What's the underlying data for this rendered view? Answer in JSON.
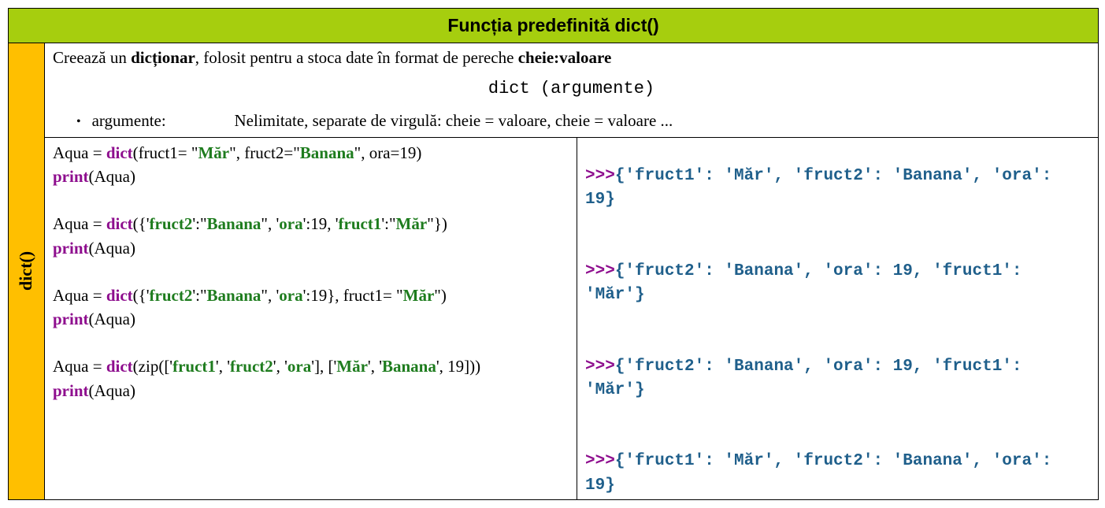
{
  "header": "Funcția predefinită dict()",
  "sidebar": "dict()",
  "desc": {
    "p1a": "Creează un ",
    "p1b": "dicționar",
    "p1c": ", folosit pentru a stoca date în format de pereche ",
    "p1d": "cheie:valoare",
    "syntax": "dict (argumente)",
    "arg_label": "argumente:",
    "arg_text": "Nelimitate, separate de virgulă: cheie = valoare, cheie = valoare ..."
  },
  "code": {
    "ex1": {
      "l1a": "Aqua = ",
      "l1b": "dict",
      "l1c": "(fruct1= \"",
      "l1d": "Măr",
      "l1e": "\", fruct2=\"",
      "l1f": "Banana",
      "l1g": "\", ora=19)",
      "l2a": "print",
      "l2b": "(Aqua)",
      "out_prompt": ">>>",
      "out": "{'fruct1': 'Măr', 'fruct2': 'Banana', 'ora': 19}"
    },
    "ex2": {
      "l1a": "Aqua = ",
      "l1b": "dict",
      "l1c": "({'",
      "l1d": "fruct2",
      "l1e": "':\"",
      "l1f": "Banana",
      "l1g": "\", '",
      "l1h": "ora",
      "l1i": "':19, '",
      "l1j": "fruct1",
      "l1k": "':\"",
      "l1l": "Măr",
      "l1m": "\"})",
      "l2a": "print",
      "l2b": "(Aqua)",
      "out_prompt": ">>>",
      "out": "{'fruct2': 'Banana', 'ora': 19, 'fruct1': 'Măr'}"
    },
    "ex3": {
      "l1a": "Aqua = ",
      "l1b": "dict",
      "l1c": "({'",
      "l1d": "fruct2",
      "l1e": "':\"",
      "l1f": "Banana",
      "l1g": "\", '",
      "l1h": "ora",
      "l1i": "':19}, fruct1= \"",
      "l1j": "Măr",
      "l1k": "\")",
      "l2a": "print",
      "l2b": "(Aqua)",
      "out_prompt": ">>>",
      "out": "{'fruct2': 'Banana', 'ora': 19, 'fruct1': 'Măr'}"
    },
    "ex4": {
      "l1a": "Aqua = ",
      "l1b": "dict",
      "l1c": "(zip(['",
      "l1d": "fruct1",
      "l1e": "', '",
      "l1f": "fruct2",
      "l1g": "', '",
      "l1h": "ora",
      "l1i": "'], ['",
      "l1j": "Măr",
      "l1k": "', '",
      "l1l": "Banana",
      "l1m": "', 19]))",
      "l2a": "print",
      "l2b": "(Aqua)",
      "out_prompt": ">>>",
      "out": "{'fruct1': 'Măr', 'fruct2': 'Banana', 'ora': 19}"
    }
  }
}
